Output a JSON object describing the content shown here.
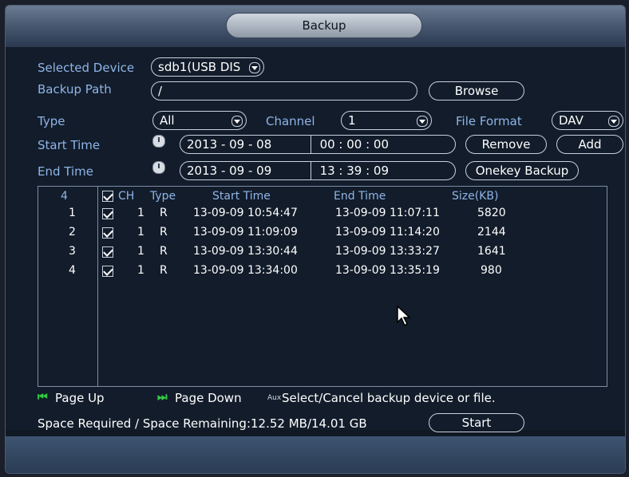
{
  "window": {
    "title": "Backup"
  },
  "form": {
    "selected_device_label": "Selected Device",
    "selected_device_value": "sdb1(USB DIS",
    "backup_path_label": "Backup Path",
    "backup_path_value": "/",
    "browse_label": "Browse",
    "type_label": "Type",
    "type_value": "All",
    "channel_label": "Channel",
    "channel_value": "1",
    "file_format_label": "File Format",
    "file_format_value": "DAV",
    "start_time_label": "Start Time",
    "start_date": "2013  - 09 - 08",
    "start_clock": "00 : 00 : 00",
    "end_time_label": "End Time",
    "end_date": "2013  - 09 - 09",
    "end_clock": "13 : 39 : 09",
    "remove_label": "Remove",
    "add_label": "Add",
    "onekey_label": "Onekey Backup"
  },
  "table": {
    "count": "4",
    "headers": {
      "ch": "CH",
      "type": "Type",
      "start": "Start Time",
      "end": "End Time",
      "size": "Size(KB)"
    },
    "rows": [
      {
        "no": "1",
        "ch": "1",
        "type": "R",
        "start": "13-09-09 10:54:47",
        "end": "13-09-09 11:07:11",
        "size": "5820"
      },
      {
        "no": "2",
        "ch": "1",
        "type": "R",
        "start": "13-09-09 11:09:09",
        "end": "13-09-09 11:14:20",
        "size": "2144"
      },
      {
        "no": "3",
        "ch": "1",
        "type": "R",
        "start": "13-09-09 13:30:44",
        "end": "13-09-09 13:33:27",
        "size": "1641"
      },
      {
        "no": "4",
        "ch": "1",
        "type": "R",
        "start": "13-09-09 13:34:00",
        "end": "13-09-09 13:35:19",
        "size": "980"
      }
    ]
  },
  "nav": {
    "page_up": "Page Up",
    "page_down": "Page Down",
    "aux": "Aux",
    "hint": "Select/Cancel backup device or file."
  },
  "space": {
    "text": "Space Required / Space Remaining:12.52 MB/14.01 GB"
  },
  "start_label": "Start",
  "icons": {
    "page_up": "skip-back-icon",
    "page_down": "skip-forward-icon",
    "clock": "clock-icon",
    "cursor": "mouse-pointer-icon"
  }
}
